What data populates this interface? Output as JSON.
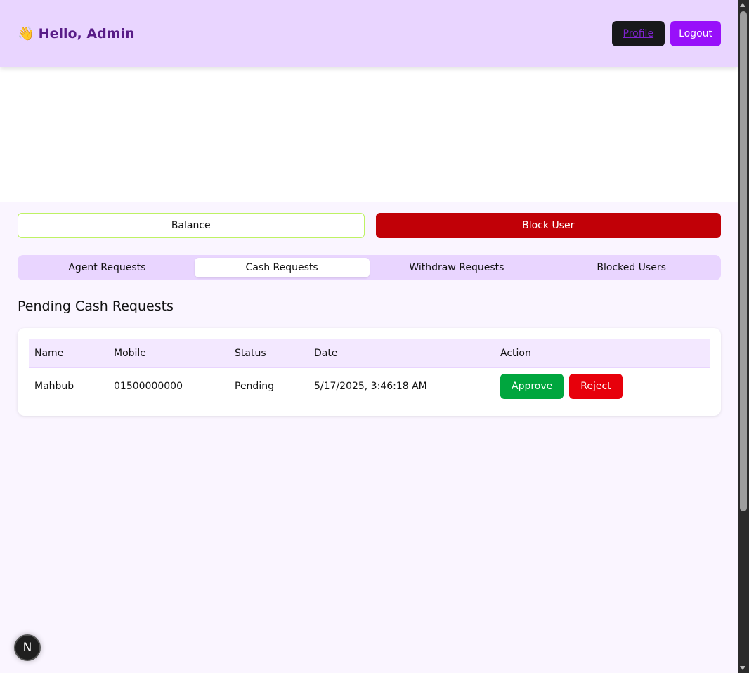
{
  "header": {
    "emoji": "👋",
    "greeting": "Hello, Admin",
    "profile_label": "Profile",
    "logout_label": "Logout"
  },
  "actions": {
    "balance_label": "Balance",
    "block_user_label": "Block User"
  },
  "tabs": [
    {
      "label": "Agent Requests",
      "active": false
    },
    {
      "label": "Cash Requests",
      "active": true
    },
    {
      "label": "Withdraw Requests",
      "active": false
    },
    {
      "label": "Blocked Users",
      "active": false
    }
  ],
  "section_title": "Pending Cash Requests",
  "table": {
    "columns": [
      "Name",
      "Mobile",
      "Status",
      "Date",
      "Action"
    ],
    "rows": [
      {
        "name": "Mahbub",
        "mobile": "01500000000",
        "status": "Pending",
        "date": "5/17/2025, 3:46:18 AM",
        "approve_label": "Approve",
        "reject_label": "Reject"
      }
    ]
  },
  "dev_badge": "N",
  "colors": {
    "header_bg": "#e9d5ff",
    "accent": "#9810fa",
    "block_user": "#c10007",
    "approve": "#00a63e",
    "reject": "#e7000b"
  }
}
